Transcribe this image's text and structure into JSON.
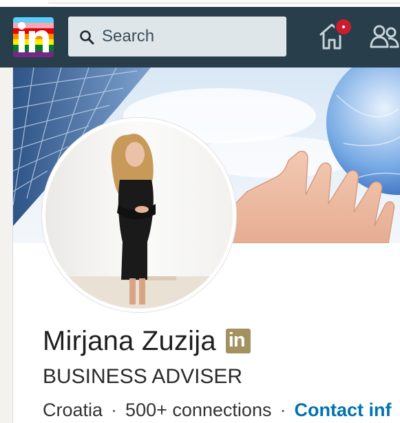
{
  "nav": {
    "logo_text": "in",
    "search_placeholder": "Search",
    "home_icon": "home-icon",
    "network_icon": "my-network-icon",
    "notification_color": "#cb1d2d"
  },
  "profile": {
    "name": "Mirjana Zuzija",
    "premium_badge_text": "in",
    "headline": "BUSINESS ADVISER",
    "location": "Croatia",
    "separator": "·",
    "connections": "500+ connections",
    "contact_label": "Contact inf"
  },
  "colors": {
    "navbar": "#283e4a",
    "link": "#0073b1",
    "badge_gold": "#a39160"
  }
}
